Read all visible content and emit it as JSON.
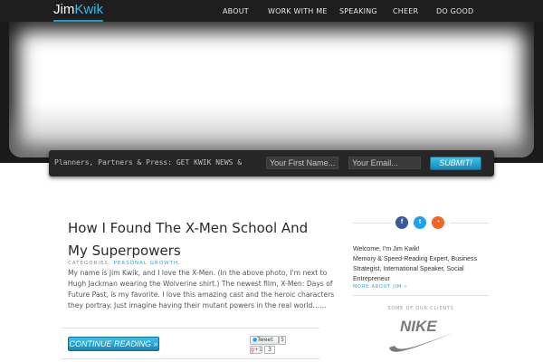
{
  "header": {
    "logo_first": "Jim",
    "logo_second": "Kwik",
    "nav": [
      "ABOUT",
      "WORK WITH ME",
      "SPEAKING",
      "CHEER",
      "DO GOOD"
    ]
  },
  "optin": {
    "text": "Planners, Partners & Press: GET KWIK NEWS &",
    "first_name_placeholder": "Your First Name...",
    "email_placeholder": "Your Email...",
    "submit_label": "SUBMIT!"
  },
  "post": {
    "title": "How I Found The X-Men School And My Superpowers",
    "categories_label": "CATEGORIES:",
    "category": "PERSONAL GROWTH.",
    "excerpt": "My name is Jim Kwik, and I love the X-Men. (In the above photo, I'm next to Hugh Jackman wearing the Wolverine shirt.) The newest film, X-Men: Days of Future Past, is my favorite. I love this amazing cast and the heroic characters they portray. Just imagine having their mutant powers in the real world……",
    "continue_label": "CONTINUE READING »",
    "tweet_label": "Tweet",
    "tweet_count": "5",
    "gplus_label": "g+1",
    "gplus_count": "3"
  },
  "sidebar": {
    "social_icons": [
      "facebook-icon",
      "twitter-icon",
      "rss-icon"
    ],
    "social_glyphs": [
      "f",
      "t",
      "◔"
    ],
    "social_colors": [
      "#3b5998",
      "#1da1f2",
      "#f26522"
    ],
    "intro": "Welcome, I'm Jim Kwik!\nMemory & Speed-Reading Expert, Business Strategist, International Speaker, Social Entrepreneur",
    "more_about": "MORE ABOUT JIM »",
    "clients_label": "SOME OF OUR CLIENTS",
    "client_logo": "NIKE"
  },
  "colors": {
    "accent": "#2aa7d6",
    "topbar": "#1e1e1e"
  }
}
